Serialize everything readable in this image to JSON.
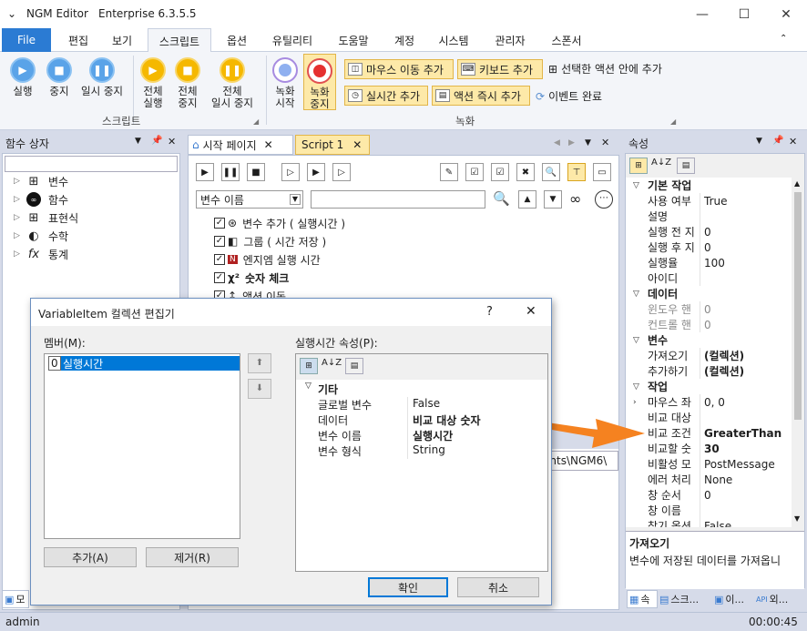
{
  "window": {
    "title": "NGM Editor",
    "edition": "Enterprise 6.3.5.5"
  },
  "menu": {
    "file": "File",
    "tabs": [
      "편집",
      "보기",
      "스크립트",
      "옵션",
      "유틸리티",
      "도움말",
      "계정",
      "시스템",
      "관리자",
      "스폰서"
    ],
    "active": "스크립트"
  },
  "ribbon": {
    "script_group": "스크립트",
    "record_group": "녹화",
    "buttons": [
      {
        "l1": "실행",
        "l2": ""
      },
      {
        "l1": "중지",
        "l2": ""
      },
      {
        "l1": "일시 중지",
        "l2": ""
      },
      {
        "l1": "전체",
        "l2": "실행"
      },
      {
        "l1": "전체",
        "l2": "중지"
      },
      {
        "l1": "전체",
        "l2": "일시 중지"
      },
      {
        "l1": "녹화",
        "l2": "시작"
      },
      {
        "l1": "녹화",
        "l2": "중지"
      }
    ],
    "record_items": [
      "마우스 이동 추가",
      "키보드 추가",
      "실시간 추가",
      "액션 즉시 추가"
    ],
    "record_plain": [
      "선택한 액션 안에 추가",
      "이벤트 완료"
    ]
  },
  "left_panel": {
    "title": "함수 상자",
    "items": [
      "변수",
      "함수",
      "표현식",
      "수학",
      "통계"
    ]
  },
  "doc": {
    "tabs": [
      "시작 페이지",
      "Script 1"
    ],
    "active": "Script 1",
    "dropdown": "변수 이름",
    "lines": [
      "변수 추가 ( 실행시간 )",
      "그룹 ( 시간 저장 )",
      "엔지엠 실행 시간",
      "숫자 체크",
      "액션 이동"
    ],
    "path": "ents\\NGM6\\"
  },
  "props": {
    "title": "속성",
    "rows": [
      {
        "t": "cat",
        "n": "기본 작업"
      },
      {
        "n": "사용 여부",
        "v": "True"
      },
      {
        "n": "설명",
        "v": ""
      },
      {
        "n": "실행 전 지",
        "v": "0"
      },
      {
        "n": "실행 후 지",
        "v": "0"
      },
      {
        "n": "실행율",
        "v": "100"
      },
      {
        "n": "아이디",
        "v": ""
      },
      {
        "t": "cat",
        "n": "데이터"
      },
      {
        "n": "윈도우 핸",
        "v": "0",
        "g": true
      },
      {
        "n": "컨트롤 핸",
        "v": "0",
        "g": true
      },
      {
        "t": "cat",
        "n": "변수"
      },
      {
        "n": "가져오기",
        "v": "(컬렉션)",
        "b": true
      },
      {
        "n": "추가하기",
        "v": "(컬렉션)",
        "b": true
      },
      {
        "t": "cat",
        "n": "작업"
      },
      {
        "n": "마우스 좌",
        "v": "0, 0",
        "x": true
      },
      {
        "n": "비교 대상",
        "v": ""
      },
      {
        "n": "비교 조건",
        "v": "GreaterThan",
        "b": true
      },
      {
        "n": "비교할 숫",
        "v": "30",
        "b": true
      },
      {
        "n": "비활성 모",
        "v": "PostMessage"
      },
      {
        "n": "에러 처리",
        "v": "None"
      },
      {
        "n": "창 순서",
        "v": "0"
      },
      {
        "n": "창 이름",
        "v": ""
      },
      {
        "n": "찾기 옵션",
        "v": "False"
      }
    ],
    "desc_title": "가져오기",
    "desc_text": "변수에 저장된 데이터를 가져옵니",
    "bottom_tabs": [
      "속",
      "스크...",
      "이...",
      "외..."
    ]
  },
  "dialog": {
    "title": "VariableItem 컬렉션 편집기",
    "help": "?",
    "members_label": "멤버(M):",
    "member_index": "0",
    "member_value": "실행시간",
    "props_label": "실행시간 속성(P):",
    "category": "기타",
    "rows": [
      {
        "n": "글로벌 변수",
        "v": "False"
      },
      {
        "n": "데이터",
        "v": "비교 대상 숫자",
        "b": true
      },
      {
        "n": "변수 이름",
        "v": "실행시간",
        "b": true
      },
      {
        "n": "변수 형식",
        "v": "String"
      }
    ],
    "add": "추가(A)",
    "remove": "제거(R)",
    "ok": "확인",
    "cancel": "취소"
  },
  "status": {
    "user": "admin",
    "time": "00:00:45"
  },
  "bottom_left_tab": "모"
}
